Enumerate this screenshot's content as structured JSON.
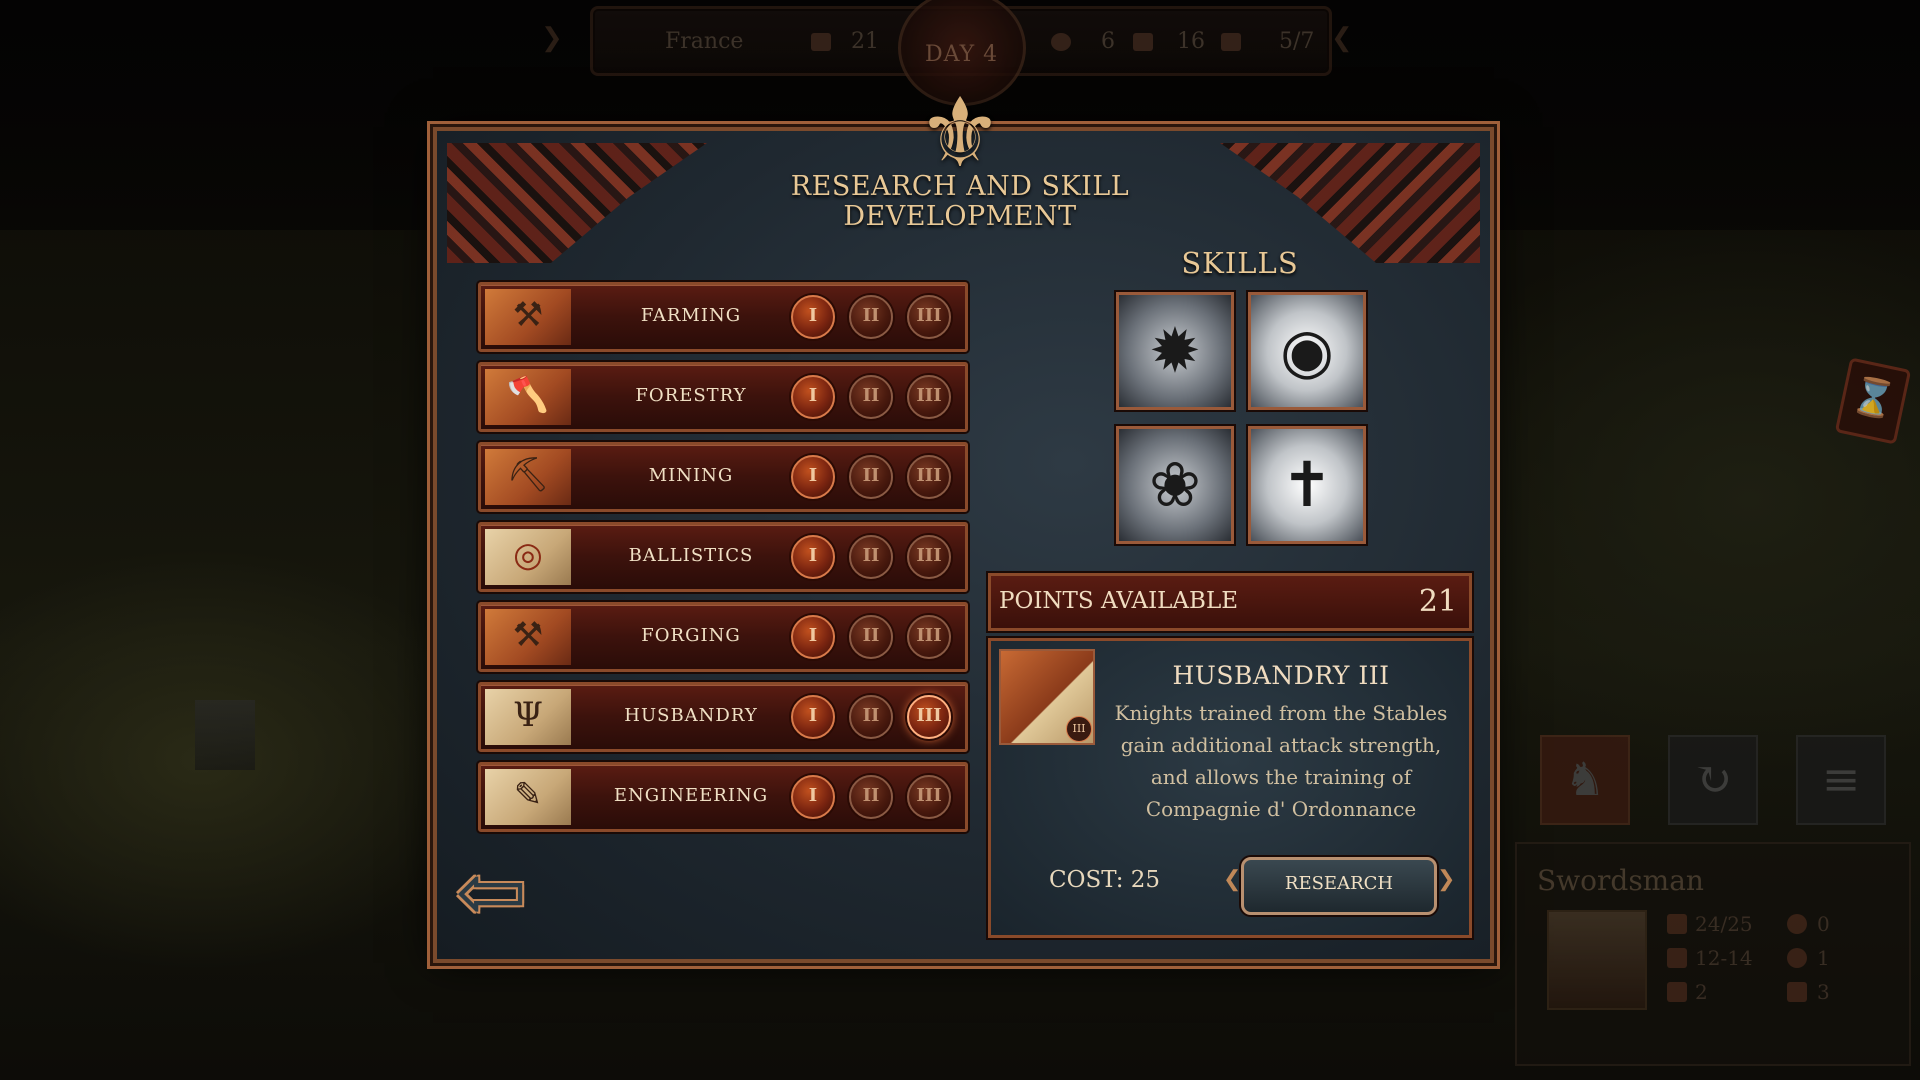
{
  "topbar": {
    "nation": "France",
    "day": "DAY 4",
    "res1": "21",
    "res2": "6",
    "res3": "16",
    "res4": "5/7"
  },
  "dialog": {
    "title": "RESEARCH AND SKILL DEVELOPMENT"
  },
  "research": {
    "rows": [
      {
        "label": "FARMING",
        "icon": "plow-icon"
      },
      {
        "label": "FORESTRY",
        "icon": "axe-icon"
      },
      {
        "label": "MINING",
        "icon": "pickaxe-icon"
      },
      {
        "label": "BALLISTICS",
        "icon": "target-icon"
      },
      {
        "label": "FORGING",
        "icon": "hammer-icon"
      },
      {
        "label": "HUSBANDRY",
        "icon": "pitchfork-icon"
      },
      {
        "label": "ENGINEERING",
        "icon": "scroll-icon"
      }
    ],
    "levels": [
      "I",
      "II",
      "III"
    ],
    "selected": "HUSBANDRY III"
  },
  "skills": {
    "title": "SKILLS",
    "icons": [
      "eagle-emblem-icon",
      "eye-icon",
      "rose-icon",
      "cross-icon"
    ]
  },
  "points": {
    "label": "POINTS AVAILABLE",
    "value": "21"
  },
  "detail": {
    "title": "HUSBANDRY III",
    "description": "Knights trained from the Stables gain additional attack strength, and allows the training of Compagnie d' Ordonnance",
    "cost": "COST: 25",
    "badge": "III",
    "research_button": "RESEARCH"
  },
  "unit": {
    "name": "Swordsman",
    "hp": "24/25",
    "attack": "12-14",
    "armor": "2",
    "kills": "0",
    "stat2": "1",
    "stat3": "3"
  },
  "colors": {
    "accent": "#8a4a2a",
    "title": "#e8c896",
    "panel": "#1f2830"
  }
}
